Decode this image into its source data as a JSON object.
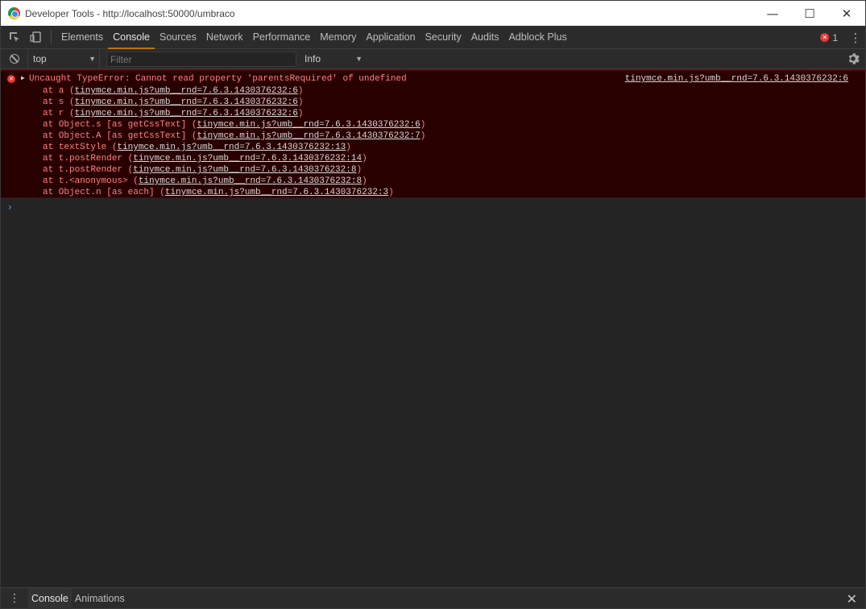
{
  "window": {
    "title": "Developer Tools - http://localhost:50000/umbraco",
    "controls": {
      "minimize": "—",
      "maximize": "☐",
      "close": "✕"
    }
  },
  "tabs": [
    {
      "label": "Elements",
      "active": false
    },
    {
      "label": "Console",
      "active": true
    },
    {
      "label": "Sources",
      "active": false
    },
    {
      "label": "Network",
      "active": false
    },
    {
      "label": "Performance",
      "active": false
    },
    {
      "label": "Memory",
      "active": false
    },
    {
      "label": "Application",
      "active": false
    },
    {
      "label": "Security",
      "active": false
    },
    {
      "label": "Audits",
      "active": false
    },
    {
      "label": "Adblock Plus",
      "active": false
    }
  ],
  "error_badge": {
    "count": "1",
    "icon": "error-x-icon"
  },
  "console_toolbar": {
    "context": "top",
    "filter_placeholder": "Filter",
    "level": "Info"
  },
  "error": {
    "message": "Uncaught TypeError: Cannot read property 'parentsRequired' of undefined",
    "source": "tinymce.min.js?umb__rnd=7.6.3.1430376232:6",
    "stack": [
      {
        "prefix": "at a (",
        "link": "tinymce.min.js?umb__rnd=7.6.3.1430376232:6",
        "suffix": ")"
      },
      {
        "prefix": "at s (",
        "link": "tinymce.min.js?umb__rnd=7.6.3.1430376232:6",
        "suffix": ")"
      },
      {
        "prefix": "at r (",
        "link": "tinymce.min.js?umb__rnd=7.6.3.1430376232:6",
        "suffix": ")"
      },
      {
        "prefix": "at Object.s [as getCssText] (",
        "link": "tinymce.min.js?umb__rnd=7.6.3.1430376232:6",
        "suffix": ")"
      },
      {
        "prefix": "at Object.A [as getCssText] (",
        "link": "tinymce.min.js?umb__rnd=7.6.3.1430376232:7",
        "suffix": ")"
      },
      {
        "prefix": "at textStyle (",
        "link": "tinymce.min.js?umb__rnd=7.6.3.1430376232:13",
        "suffix": ")"
      },
      {
        "prefix": "at t.postRender (",
        "link": "tinymce.min.js?umb__rnd=7.6.3.1430376232:14",
        "suffix": ")"
      },
      {
        "prefix": "at t.postRender (",
        "link": "tinymce.min.js?umb__rnd=7.6.3.1430376232:8",
        "suffix": ")"
      },
      {
        "prefix": "at t.<anonymous> (",
        "link": "tinymce.min.js?umb__rnd=7.6.3.1430376232:8",
        "suffix": ")"
      },
      {
        "prefix": "at Object.n [as each] (",
        "link": "tinymce.min.js?umb__rnd=7.6.3.1430376232:3",
        "suffix": ")"
      }
    ]
  },
  "prompt_symbol": "›",
  "drawer": {
    "tabs": [
      {
        "label": "Console",
        "active": true
      },
      {
        "label": "Animations",
        "active": false
      }
    ],
    "close": "✕"
  }
}
